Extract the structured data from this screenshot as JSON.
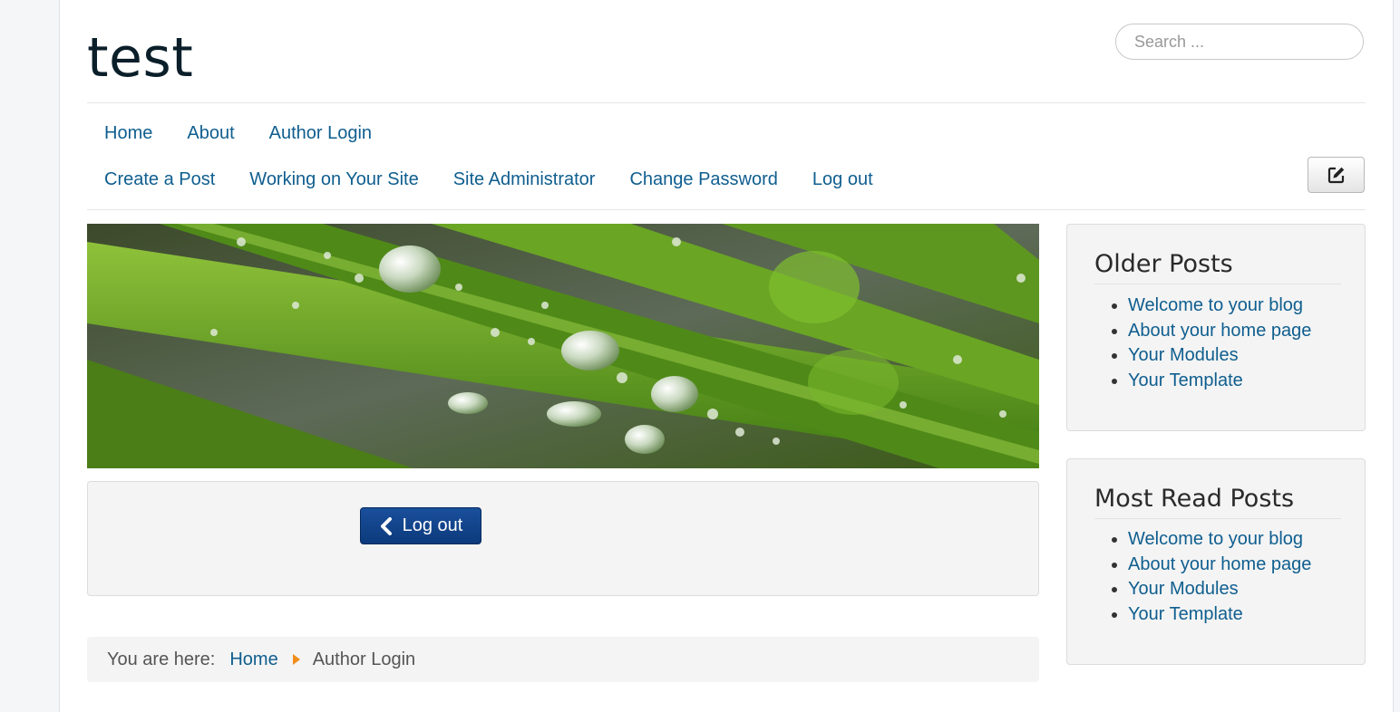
{
  "site": {
    "title": "test"
  },
  "search": {
    "placeholder": "Search ..."
  },
  "nav": {
    "primary": [
      {
        "label": "Home"
      },
      {
        "label": "About"
      },
      {
        "label": "Author Login"
      }
    ],
    "secondary": [
      {
        "label": "Create a Post"
      },
      {
        "label": "Working on Your Site"
      },
      {
        "label": "Site Administrator"
      },
      {
        "label": "Change Password"
      },
      {
        "label": "Log out"
      }
    ],
    "edit_icon": "edit-icon"
  },
  "login_module": {
    "button_label": "Log out",
    "button_icon": "chevron-left-icon"
  },
  "breadcrumb": {
    "prefix": "You are here:",
    "home": "Home",
    "current": "Author Login"
  },
  "sidebar": {
    "older_posts": {
      "title": "Older Posts",
      "items": [
        "Welcome to your blog",
        "About your home page",
        "Your Modules",
        "Your Template"
      ]
    },
    "most_read": {
      "title": "Most Read Posts",
      "items": [
        "Welcome to your blog",
        "About your home page",
        "Your Modules",
        "Your Template"
      ]
    }
  },
  "colors": {
    "link": "#0f5e8f",
    "button": "#0c3a7c",
    "accent": "#f08d1b"
  }
}
